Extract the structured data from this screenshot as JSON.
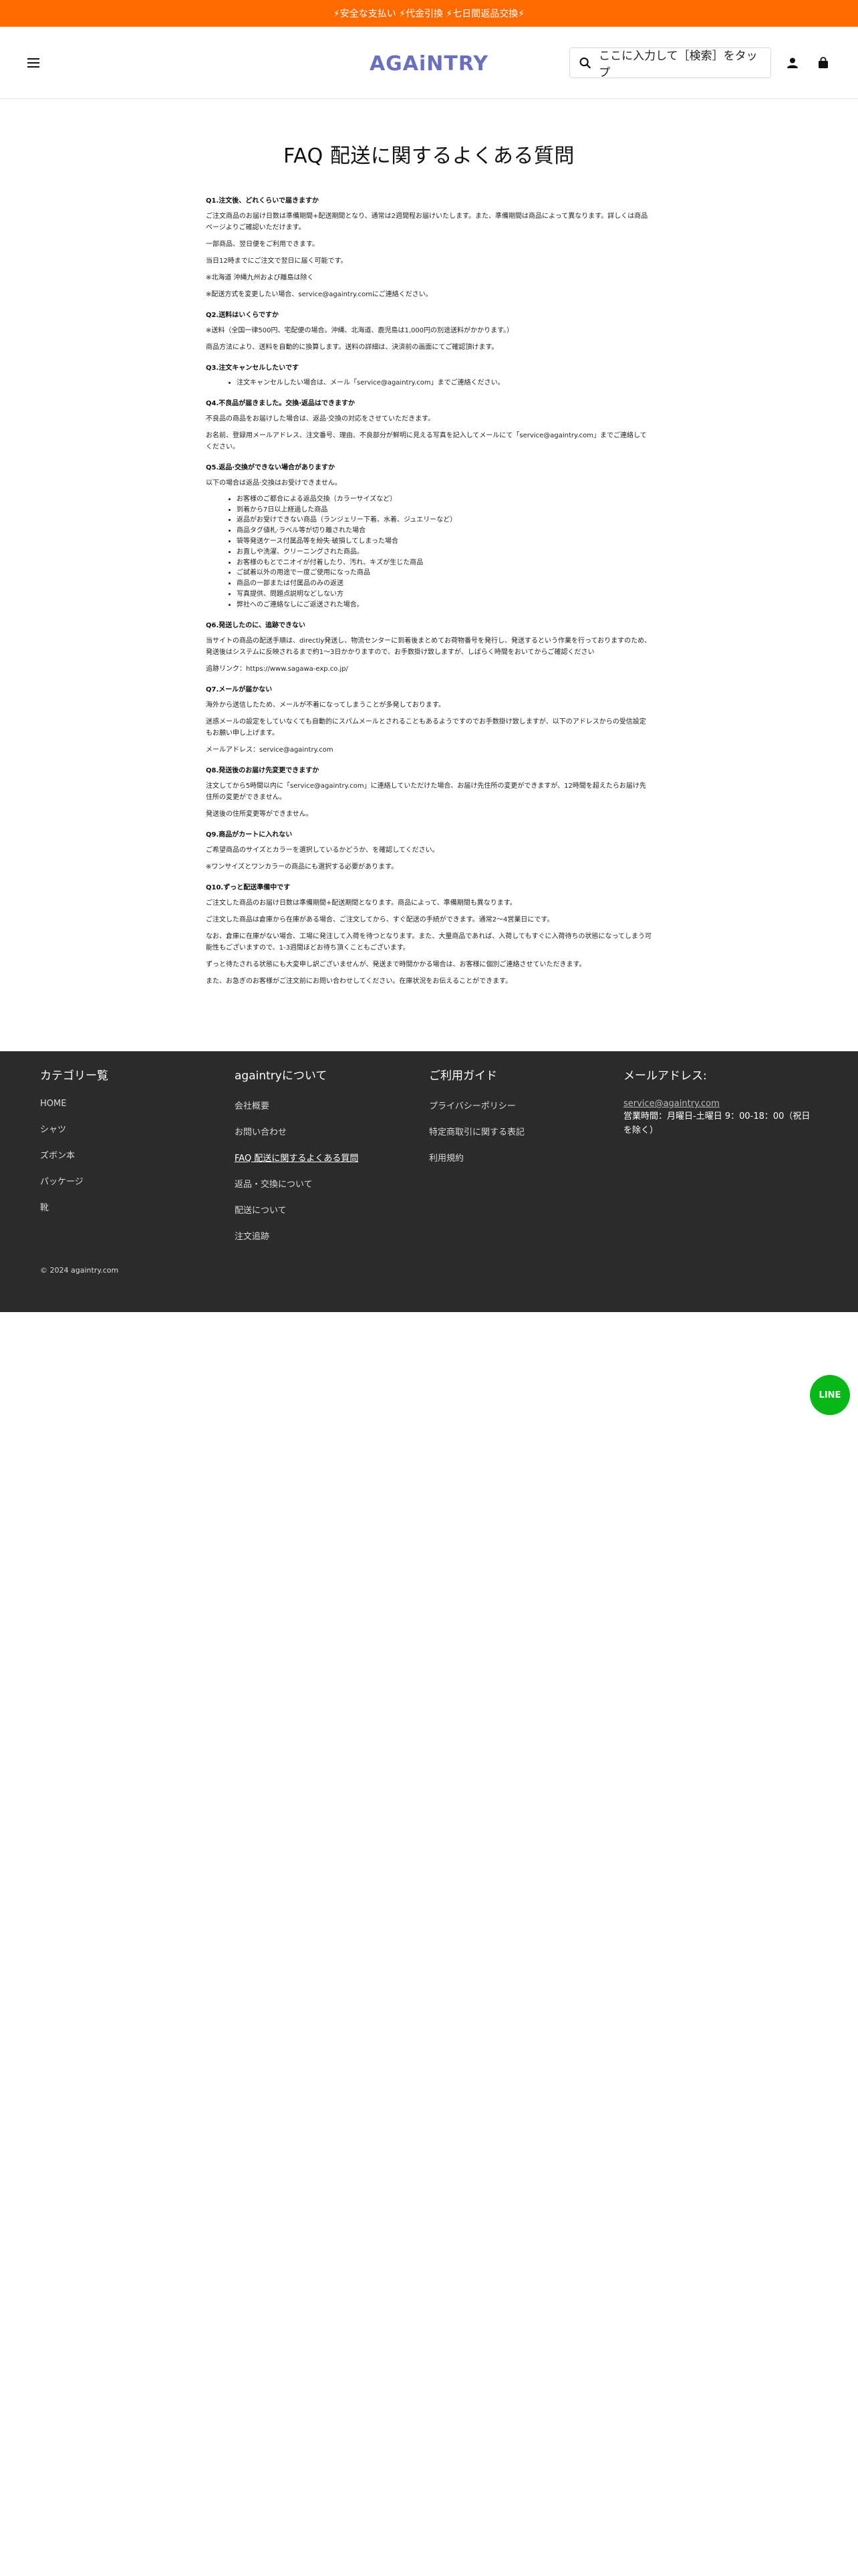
{
  "announcement": "⚡安全な支払い ⚡代金引換 ⚡七日間返品交換⚡",
  "header": {
    "logo": "AGAiNTRY",
    "search_placeholder": "ここに入力して［検索］をタップ"
  },
  "page_title": "FAQ 配送に関するよくある質問",
  "faq": [
    {
      "kind": "q",
      "text": "Q1.注文後、どれくらいで届きますか"
    },
    {
      "kind": "p",
      "text": "ご注文商品のお届け日数は準備期間+配送期間となり、通常は2週間程お届けいたします。また、準備期間は商品によって異なります。詳しくは商品ページよりご確認いただけます。"
    },
    {
      "kind": "p",
      "text": "一部商品、翌日便をご利用できます。"
    },
    {
      "kind": "p",
      "text": "当日12時までにご注文で翌日に届く可能です。"
    },
    {
      "kind": "p",
      "text": "※北海道 沖縄九州および離島は除く"
    },
    {
      "kind": "p",
      "text": "※配送方式を変更したい場合、service@againtry.comにご連絡ください。"
    },
    {
      "kind": "q",
      "text": "Q2.送料はいくらですか"
    },
    {
      "kind": "p",
      "text": "※送料（全国一律500円、宅配便の場合。沖縄、北海道、鹿児島は1,000円の別途送料がかかります。）"
    },
    {
      "kind": "p",
      "text": "商品方法により、送料を自動的に換算します。送料の詳細は、決済前の画面にてご確認頂けます。"
    },
    {
      "kind": "q",
      "text": "Q3.注文キャンセルしたいです"
    },
    {
      "kind": "list",
      "items": [
        "注文キャンセルしたい場合は、メール「service@againtry.com」までご連絡ください。"
      ]
    },
    {
      "kind": "q",
      "text": "Q4.不良品が届きました。交換·返品はできますか"
    },
    {
      "kind": "p",
      "text": "不良品の商品をお届けした場合は、返品·交換の対応をさせていただきます。"
    },
    {
      "kind": "p",
      "text": "お名前、登録用メールアドレス、注文番号、理由、不良部分が鮮明に見える写真を記入してメールにて「service@againtry.com」までご連絡してください。"
    },
    {
      "kind": "q",
      "text": "Q5.返品·交換ができない場合がありますか"
    },
    {
      "kind": "p",
      "text": "以下の場合は返品·交換はお受けできません。"
    },
    {
      "kind": "list",
      "items": [
        "お客様のご都合による返品交換（カラーサイズなど）",
        "到着から7日以上経過した商品",
        "返品がお受けできない商品（ランジェリー下着、水着、ジュエリーなど）",
        "商品タグ値札·ラベル等が切り離された場合",
        "袋等発送ケース付属品等を紛失·破損してしまった場合",
        "お直しや洗濯、クリーニングされた商品。",
        "お客様のもとでニオイが付着したり、汚れ、キズが生じた商品",
        "ご試着以外の用途で一度ご使用になった商品",
        "商品の一部または付属品のみの返送",
        "写真提供、問題点説明などしない方",
        "弊社へのご連絡なしにご返送された場合。"
      ]
    },
    {
      "kind": "q",
      "text": "Q6.発送したのに、追跡できない"
    },
    {
      "kind": "p",
      "text": "当サイトの商品の配送手順は、directly発送し、物流センターに到着後まとめてお荷物番号を発行し、発送するという作業を行っておりますのため、発送後はシステムに反映されるまで約1～3日かかりますので、お手数掛け致しますが、しばらく時間をおいてからご確認ください"
    },
    {
      "kind": "p",
      "text": "追跡リンク：https://www.sagawa-exp.co.jp/"
    },
    {
      "kind": "q",
      "text": "Q7.メールが届かない"
    },
    {
      "kind": "p",
      "text": "海外から送信したため、メールが不着になってしまうことが多発しております。"
    },
    {
      "kind": "p",
      "text": "迷惑メールの設定をしていなくても自動的にスパムメールとされることもあるようですのでお手数掛け致しますが、以下のアドレスからの受信設定もお願い申し上げます。"
    },
    {
      "kind": "p",
      "text": "メールアドレス：service@againtry.com"
    },
    {
      "kind": "q",
      "text": "Q8.発送後のお届け先変更できますか"
    },
    {
      "kind": "p",
      "text": "注文してから5時間以内に「service@againtry.com」に連絡していただけた場合、お届け先住所の変更ができますが、12時間を超えたらお届け先住所の変更ができません。"
    },
    {
      "kind": "p",
      "text": "発送後の住所変更等ができません。"
    },
    {
      "kind": "q",
      "text": "Q9.商品がカートに入れない"
    },
    {
      "kind": "p",
      "text": "ご希望商品のサイズとカラーを選択しているかどうか、を確認してください。"
    },
    {
      "kind": "p",
      "text": "※ワンサイズとワンカラーの商品にも選択する必要があります。"
    },
    {
      "kind": "q",
      "text": "Q10.ずっと配送準備中です"
    },
    {
      "kind": "p",
      "text": "ご注文した商品のお届け日数は準備期間+配送期間となります。商品によって、準備期間も異なります。"
    },
    {
      "kind": "p",
      "text": "ご注文した商品は倉庫から在庫がある場合、ご注文してから、すぐ配送の手続ができます。通常2～4営業日にです。"
    },
    {
      "kind": "p",
      "text": "なお、倉庫に在庫がない場合、工場に発注して入荷を待つとなります。また、大量商品であれば、入荷してもすぐに入荷待ちの状態になってしまう可能性もございますので、1-3週間ほどお待ち頂くこともございます。"
    },
    {
      "kind": "p",
      "text": "ずっと待たされる状態にも大変申し訳ございませんが、発送まで時間かかる場合は、お客様に個別ご連絡させていただきます。"
    },
    {
      "kind": "p",
      "text": "また、お急ぎのお客様がご注文前にお問い合わせしてください。在庫状況をお伝えることができます。"
    }
  ],
  "footer": {
    "col1": {
      "title": "カテゴリー覧",
      "links": [
        "HOME",
        "シャツ",
        "ズボン本",
        "パッケージ",
        "靴"
      ]
    },
    "col2": {
      "title": "againtryについて",
      "links": [
        "会社概要",
        "お問い合わせ",
        "FAQ 配送に関するよくある質問",
        "返品・交換について",
        "配送について",
        "注文追跡"
      ],
      "active_index": 2
    },
    "col3": {
      "title": "ご利用ガイド",
      "links": [
        "プライバシーポリシー",
        "特定商取引に関する表記",
        "利用規約"
      ]
    },
    "col4": {
      "title": "メールアドレス:",
      "email": "service@againtry.com",
      "hours": "営業時間：月曜日-土曜日 9：00-18：00（祝日を除く）"
    },
    "copyright": "© 2024 againtry.com"
  },
  "line_button": "LINE",
  "colors": {
    "announcement_bg": "#ff6a00",
    "logo": "#6a6fbf",
    "footer_bg": "#2b2b2b",
    "line_green": "#08b818"
  }
}
